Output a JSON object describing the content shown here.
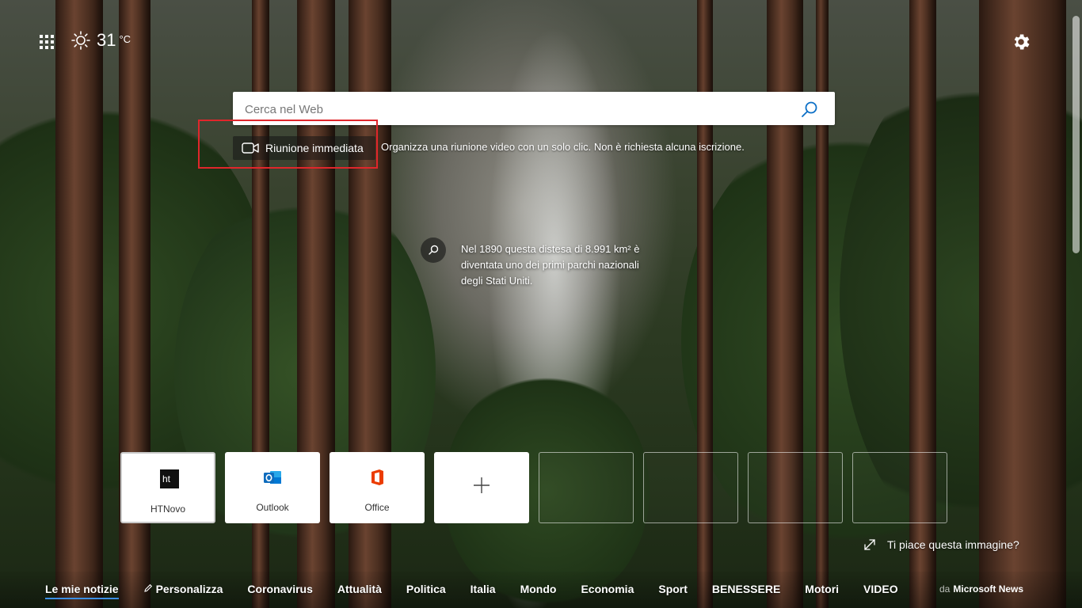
{
  "weather": {
    "icon": "sun-icon",
    "temperature": "31",
    "unit": "°C"
  },
  "search": {
    "placeholder": "Cerca nel Web",
    "icon": "search-icon"
  },
  "meeting": {
    "button_label": "Riunione immediata",
    "description": "Organizza una riunione video con un solo clic. Non è richiesta alcuna iscrizione.",
    "icon": "video-camera-icon",
    "highlight_color": "#e0262b"
  },
  "image_fact": {
    "line1": "Nel 1890 questa distesa di 8.991 km² è",
    "line2": "diventata uno dei primi parchi nazionali",
    "line3": "degli Stati Uniti."
  },
  "quick_links": [
    {
      "name": "HTNovo",
      "icon": "htnovo-logo-icon"
    },
    {
      "name": "Outlook",
      "icon": "outlook-logo-icon",
      "color": "#0f6cbd"
    },
    {
      "name": "Office",
      "icon": "office-logo-icon",
      "color": "#eb3c00"
    },
    {
      "name": "",
      "icon": "add-icon"
    }
  ],
  "like_image": {
    "label": "Ti piace questa immagine?",
    "icon": "expand-icon"
  },
  "news_nav": {
    "items": [
      "Le mie notizie",
      "Personalizza",
      "Coronavirus",
      "Attualità",
      "Politica",
      "Italia",
      "Mondo",
      "Economia",
      "Sport",
      "BENESSERE",
      "Motori",
      "VIDEO"
    ],
    "active_index": 0,
    "accent": "#3b8fe6"
  },
  "powered_by": {
    "prefix": "da",
    "brand": "Microsoft News"
  }
}
